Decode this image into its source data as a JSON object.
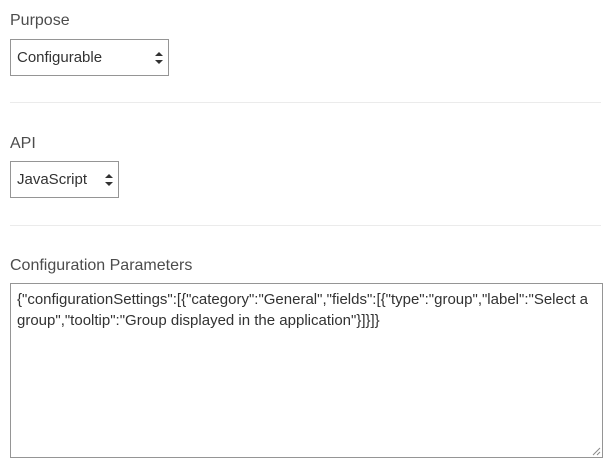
{
  "purpose": {
    "label": "Purpose",
    "selected": "Configurable",
    "icon": "updown-chevron-icon"
  },
  "api": {
    "label": "API",
    "selected": "JavaScript",
    "icon": "updown-chevron-icon"
  },
  "configuration": {
    "label": "Configuration Parameters",
    "value": "{\"configurationSettings\":[{\"category\":\"General\",\"fields\":[{\"type\":\"group\",\"label\":\"Select a group\",\"tooltip\":\"Group displayed in the application\"}]}]}"
  },
  "colors": {
    "border": "#959595",
    "divider": "#ebebeb",
    "label": "#4c4c4c",
    "text": "#323232"
  }
}
